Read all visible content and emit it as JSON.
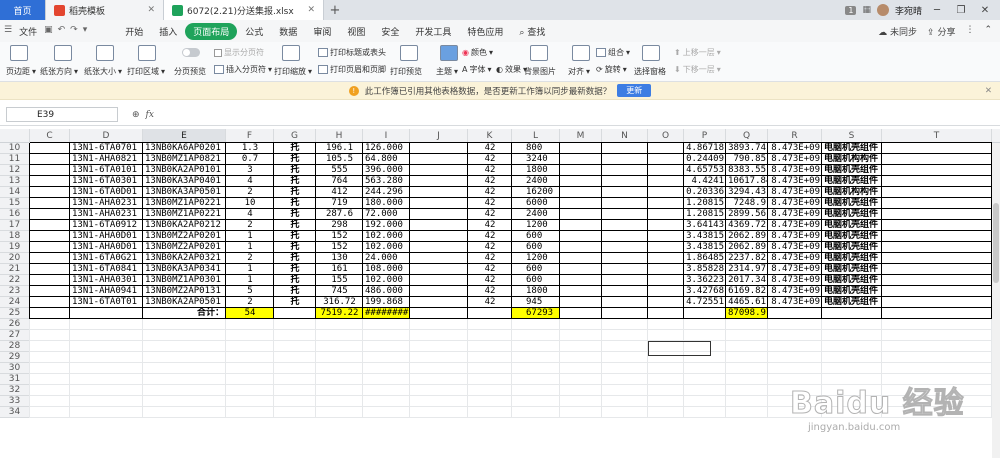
{
  "titlebar": {
    "tabs": [
      {
        "label": "首页"
      },
      {
        "label": "稻壳模板"
      },
      {
        "label": "6072(2.21)分送集报.xlsx"
      }
    ],
    "page_count": "1",
    "user": "李宛晴"
  },
  "menubar": {
    "file": "文件",
    "items": [
      "开始",
      "插入",
      "页面布局",
      "公式",
      "数据",
      "审阅",
      "视图",
      "安全",
      "开发工具",
      "特色应用"
    ],
    "search": "查找",
    "sync": "未同步",
    "share": "分享"
  },
  "ribbon": {
    "margins": "页边距",
    "orientation": "纸张方向",
    "size": "纸张大小",
    "print_area": "打印区域",
    "page_break_preview": "分页预览",
    "show_page_breaks": "显示分页符",
    "insert_page_break": "插入分页符",
    "print_scale": "打印缩放",
    "print_titles": "打印标题或表头",
    "header_footer": "打印页眉和页脚",
    "print_preview": "打印预览",
    "theme": "主题",
    "colors": "颜色",
    "fonts": "字体",
    "effects": "效果",
    "background": "背景图片",
    "align": "对齐",
    "group": "组合",
    "rotate": "旋转",
    "selection_pane": "选择窗格",
    "bring_forward": "上移一层",
    "send_backward": "下移一层"
  },
  "notify": {
    "message": "此工作簿已引用其他表格数据，是否更新工作簿以同步最新数据？",
    "button": "更新"
  },
  "formulabar": {
    "name_box": "E39",
    "fx": "fx"
  },
  "columns": [
    "C",
    "D",
    "E",
    "F",
    "G",
    "H",
    "I",
    "J",
    "K",
    "L",
    "M",
    "N",
    "O",
    "P",
    "Q",
    "R",
    "S",
    "T"
  ],
  "rows": [
    {
      "n": "10",
      "D": "13N1-6TA0701",
      "E": "13NB0KA6AP0201",
      "F": "1.3",
      "G": "托",
      "H": "196.1",
      "I": "126.000",
      "K": "42",
      "L": "800",
      "P": "4.86718",
      "Q": "3893.74",
      "R": "8.473E+09",
      "S": "电脑机壳组件"
    },
    {
      "n": "11",
      "D": "13N1-AHA0821",
      "E": "13NB0MZ1AP0821",
      "F": "0.7",
      "G": "托",
      "H": "105.5",
      "I": "64.800",
      "K": "42",
      "L": "3240",
      "P": "0.24409",
      "Q": "790.85",
      "R": "8.473E+09",
      "S": "电脑机构构件"
    },
    {
      "n": "12",
      "D": "13N1-6TA0101",
      "E": "13NB0KA2AP0101",
      "F": "3",
      "G": "托",
      "H": "555",
      "I": "396.000",
      "K": "42",
      "L": "1800",
      "P": "4.65753",
      "Q": "8383.55",
      "R": "8.473E+09",
      "S": "电脑机壳组件"
    },
    {
      "n": "13",
      "D": "13N1-6TA0301",
      "E": "13NB0KA3AP0401",
      "F": "4",
      "G": "托",
      "H": "764",
      "I": "563.280",
      "K": "42",
      "L": "2400",
      "P": "4.4241",
      "Q": "10617.84",
      "R": "8.473E+09",
      "S": "电脑机壳组件"
    },
    {
      "n": "14",
      "D": "13N1-6TA0D01",
      "E": "13NB0KA3AP0501",
      "F": "2",
      "G": "托",
      "H": "412",
      "I": "244.296",
      "K": "42",
      "L": "16200",
      "P": "0.20336",
      "Q": "3294.43",
      "R": "8.473E+09",
      "S": "电脑机构构件"
    },
    {
      "n": "15",
      "D": "13N1-AHA0231",
      "E": "13NB0MZ1AP0221",
      "F": "10",
      "G": "托",
      "H": "719",
      "I": "180.000",
      "K": "42",
      "L": "6000",
      "P": "1.20815",
      "Q": "7248.9",
      "R": "8.473E+09",
      "S": "电脑机壳组件"
    },
    {
      "n": "16",
      "D": "13N1-AHA0231",
      "E": "13NB0MZ1AP0221",
      "F": "4",
      "G": "托",
      "H": "287.6",
      "I": "72.000",
      "K": "42",
      "L": "2400",
      "P": "1.20815",
      "Q": "2899.56",
      "R": "8.473E+09",
      "S": "电脑机壳组件"
    },
    {
      "n": "17",
      "D": "13N1-6TA0912",
      "E": "13NB0KA2AP0212",
      "F": "2",
      "G": "托",
      "H": "298",
      "I": "192.000",
      "K": "42",
      "L": "1200",
      "P": "3.64143",
      "Q": "4369.72",
      "R": "8.473E+09",
      "S": "电脑机壳组件"
    },
    {
      "n": "18",
      "D": "13N1-AHA0D01",
      "E": "13NB0MZ2AP0201",
      "F": "1",
      "G": "托",
      "H": "152",
      "I": "102.000",
      "K": "42",
      "L": "600",
      "P": "3.43815",
      "Q": "2062.89",
      "R": "8.473E+09",
      "S": "电脑机壳组件"
    },
    {
      "n": "19",
      "D": "13N1-AHA0D01",
      "E": "13NB0MZ2AP0201",
      "F": "1",
      "G": "托",
      "H": "152",
      "I": "102.000",
      "K": "42",
      "L": "600",
      "P": "3.43815",
      "Q": "2062.89",
      "R": "8.473E+09",
      "S": "电脑机壳组件"
    },
    {
      "n": "20",
      "D": "13N1-6TA0G21",
      "E": "13NB0KA2AP0321",
      "F": "2",
      "G": "托",
      "H": "130",
      "I": "24.000",
      "K": "42",
      "L": "1200",
      "P": "1.86485",
      "Q": "2237.82",
      "R": "8.473E+09",
      "S": "电脑机壳组件"
    },
    {
      "n": "21",
      "D": "13N1-6TA0841",
      "E": "13NB0KA3AP0341",
      "F": "1",
      "G": "托",
      "H": "161",
      "I": "108.000",
      "K": "42",
      "L": "600",
      "P": "3.85828",
      "Q": "2314.97",
      "R": "8.473E+09",
      "S": "电脑机壳组件"
    },
    {
      "n": "22",
      "D": "13N1-AHA0301",
      "E": "13NB0MZ1AP0301",
      "F": "1",
      "G": "托",
      "H": "155",
      "I": "102.000",
      "K": "42",
      "L": "600",
      "P": "3.36223",
      "Q": "2017.34",
      "R": "8.473E+09",
      "S": "电脑机壳组件"
    },
    {
      "n": "23",
      "D": "13N1-AHA0941",
      "E": "13NB0MZ2AP0131",
      "F": "5",
      "G": "托",
      "H": "745",
      "I": "486.000",
      "K": "42",
      "L": "1800",
      "P": "3.42768",
      "Q": "6169.82",
      "R": "8.473E+09",
      "S": "电脑机壳组件"
    },
    {
      "n": "24",
      "D": "13N1-6TA0T01",
      "E": "13NB0KA2AP0501",
      "F": "2",
      "G": "托",
      "H": "316.72",
      "I": "199.868",
      "K": "42",
      "L": "945",
      "P": "4.72551",
      "Q": "4465.61",
      "R": "8.473E+09",
      "S": "电脑机壳组件"
    },
    {
      "n": "25",
      "E": "合计：",
      "F": "54",
      "H": "7519.22",
      "I": "########",
      "L": "67293",
      "Q": "87098.97"
    }
  ],
  "empty_rows": [
    "26",
    "27",
    "28",
    "29",
    "30",
    "31",
    "32",
    "33",
    "34"
  ],
  "watermark": {
    "main": "Baidu 经验",
    "sub": "jingyan.baidu.com"
  },
  "colors": {
    "accent": "#1fa35b",
    "highlight": "#ffff00",
    "tab_blue": "#2f6fd6"
  }
}
